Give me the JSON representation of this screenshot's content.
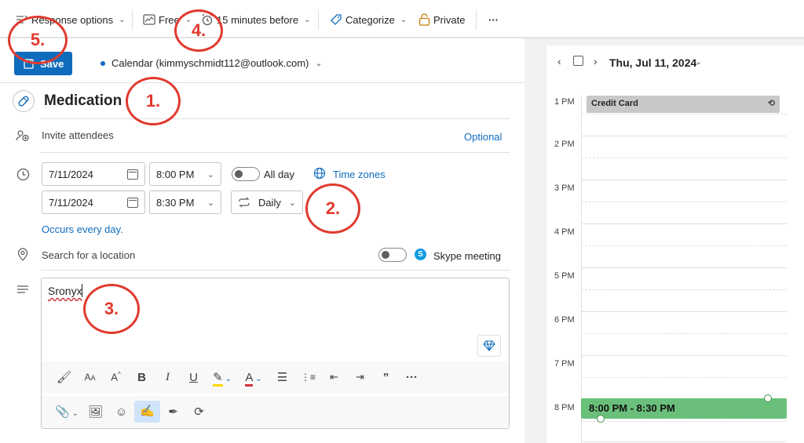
{
  "toolbar": {
    "response_options": "Response options",
    "free": "Free",
    "reminder": "15 minutes before",
    "categorize": "Categorize",
    "private": "Private",
    "more": "···"
  },
  "form": {
    "save_label": "Save",
    "calendar": "Calendar (kimmyschmidt112@outlook.com)",
    "title": "Medication",
    "invite_placeholder": "Invite attendees",
    "optional_label": "Optional",
    "start_date": "7/11/2024",
    "start_time": "8:00 PM",
    "all_day_label": "All day",
    "time_zones_label": "Time zones",
    "end_date": "7/11/2024",
    "end_time": "8:30 PM",
    "repeat": "Daily",
    "occurs_text": "Occurs every day.",
    "location_placeholder": "Search for a location",
    "skype_label": "Skype meeting",
    "body_text": "Sronyx",
    "all_day_on": false,
    "skype_on": false
  },
  "annotations": [
    "1.",
    "2.",
    "3.",
    "4.",
    "5."
  ],
  "calendar_pane": {
    "date_label": "Thu, Jul 11, 2024",
    "hours": [
      "1 PM",
      "2 PM",
      "3 PM",
      "4 PM",
      "5 PM",
      "6 PM",
      "7 PM",
      "8 PM"
    ],
    "events": [
      {
        "title": "Credit Card",
        "color": "#c8c8c8"
      },
      {
        "title": "8:00 PM - 8:30 PM",
        "color": "#6ac07a"
      }
    ]
  },
  "colors": {
    "accent": "#0f6cbd",
    "annotation": "#e03a2f",
    "event_green": "#6ac07a"
  }
}
